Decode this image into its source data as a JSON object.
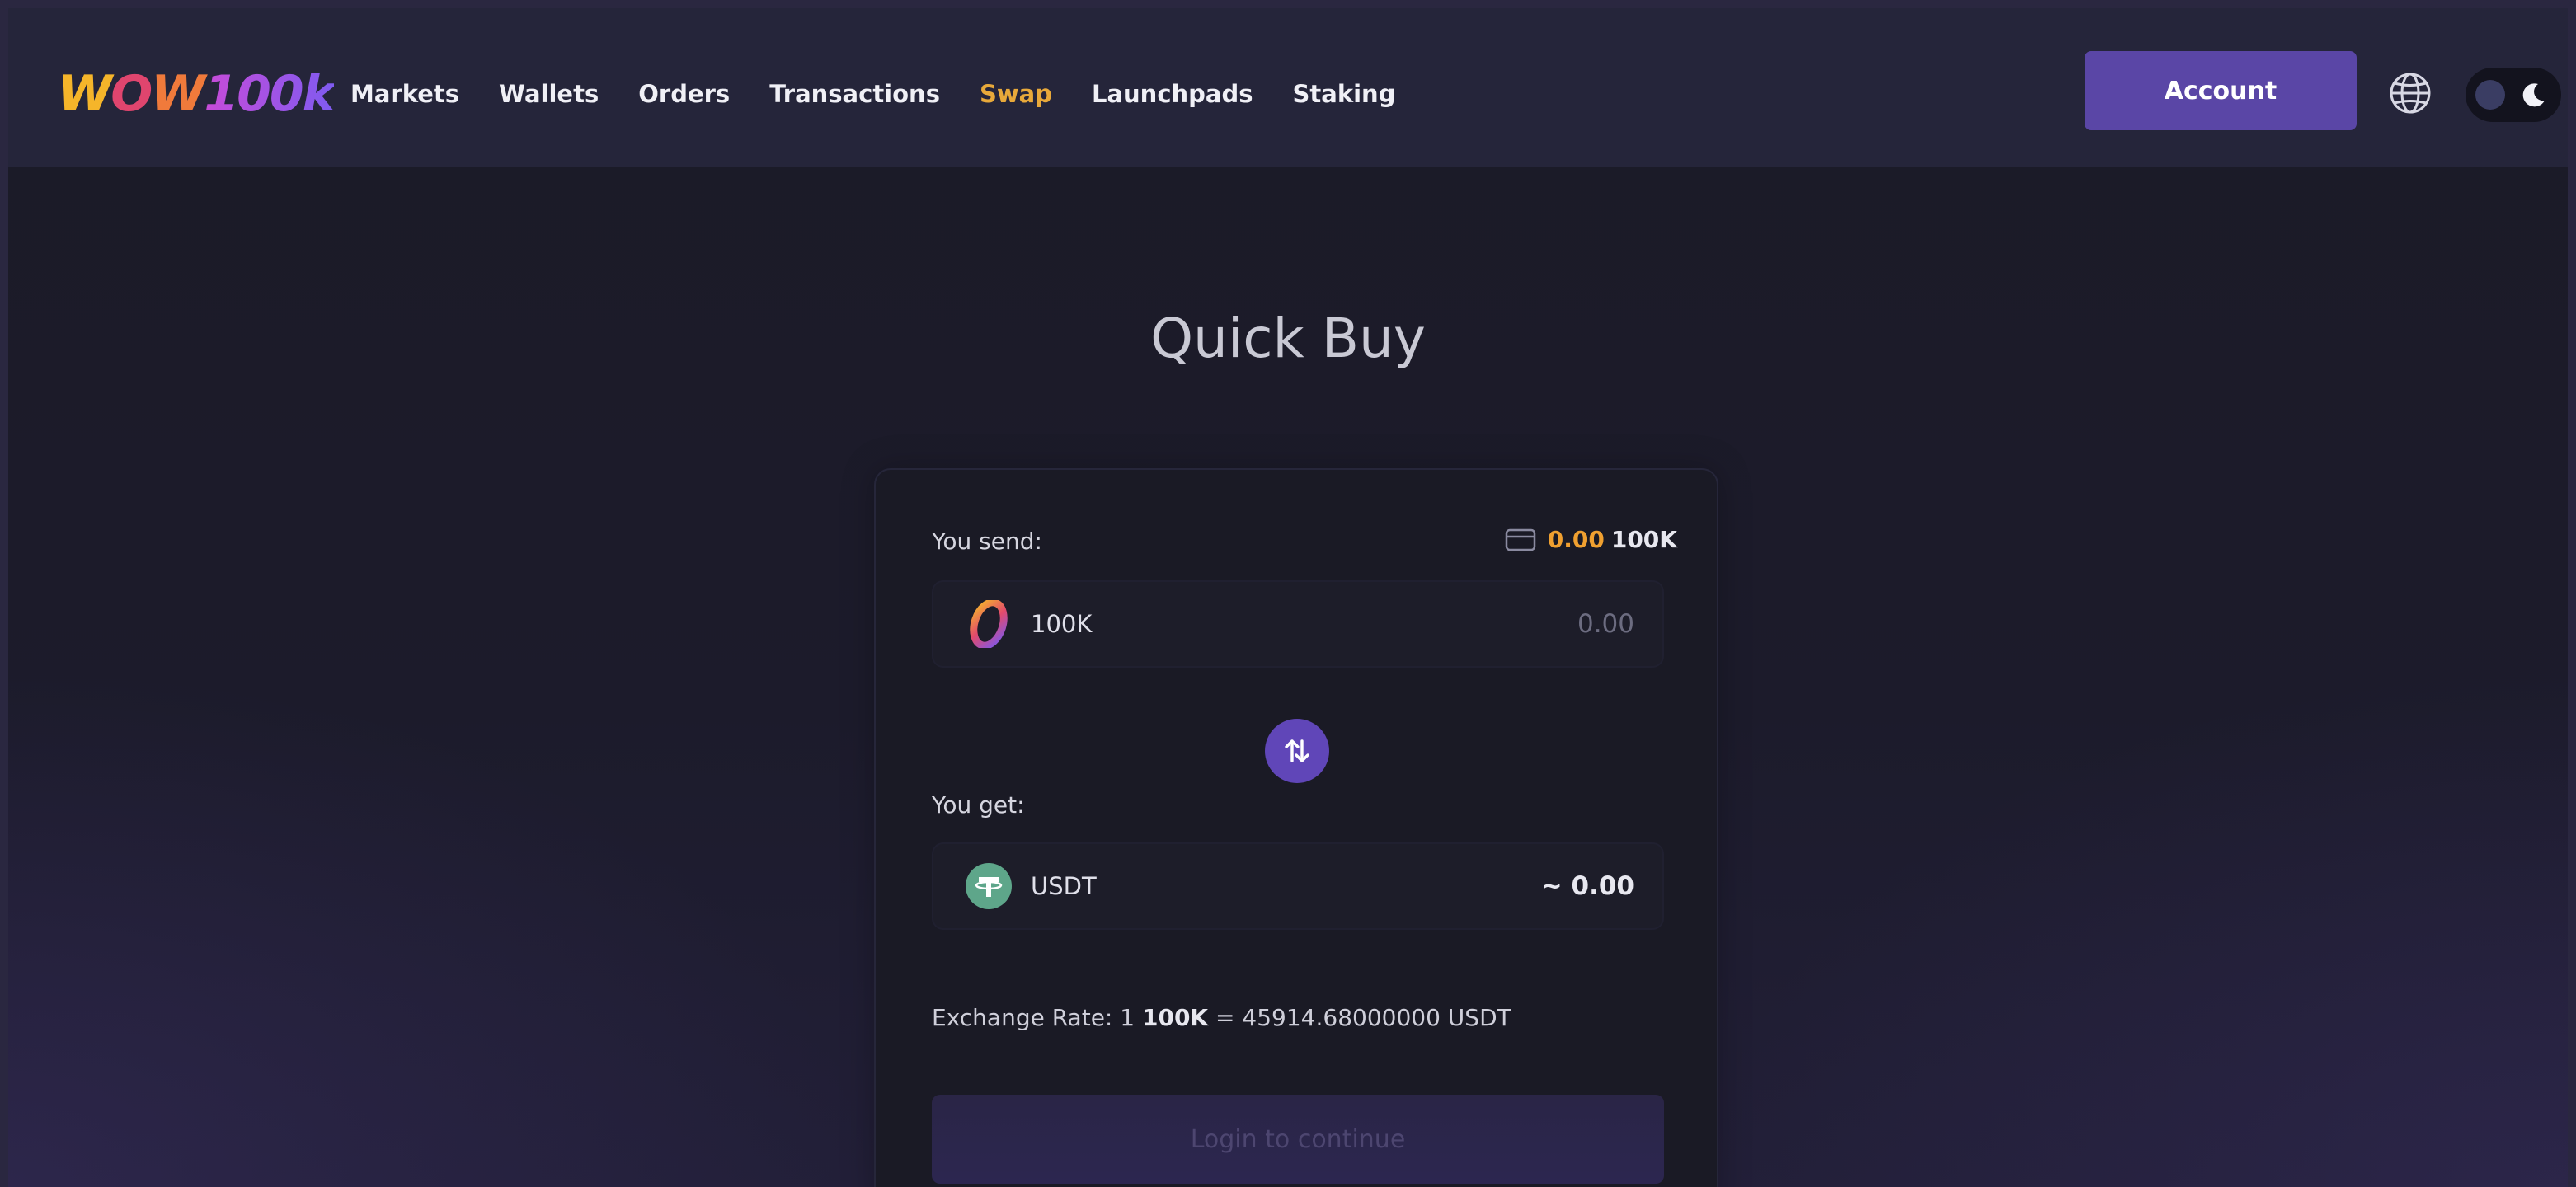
{
  "header": {
    "logo_text": "wow100k",
    "nav": [
      {
        "label": "Markets"
      },
      {
        "label": "Wallets"
      },
      {
        "label": "Orders"
      },
      {
        "label": "Transactions"
      },
      {
        "label": "Swap",
        "active": true
      },
      {
        "label": "Launchpads"
      },
      {
        "label": "Staking"
      }
    ],
    "account_label": "Account",
    "icons": [
      "globe-icon",
      "moon-icon"
    ]
  },
  "main": {
    "title": "Quick Buy",
    "send": {
      "label": "You send:",
      "balance_amount": "0.00",
      "balance_currency": "100K",
      "currency": "100K",
      "placeholder": "0.00"
    },
    "get": {
      "label": "You get:",
      "currency": "USDT",
      "value": "~ 0.00"
    },
    "exchange_rate": {
      "prefix": "Exchange Rate: 1",
      "base": "100K",
      "rest": "= 45914.68000000 USDT"
    },
    "login_label": "Login to continue"
  },
  "colors": {
    "accent": "#5a46a6",
    "active_nav": "#e8a93a",
    "balance": "#f0a030",
    "usdt": "#5ea68a"
  }
}
